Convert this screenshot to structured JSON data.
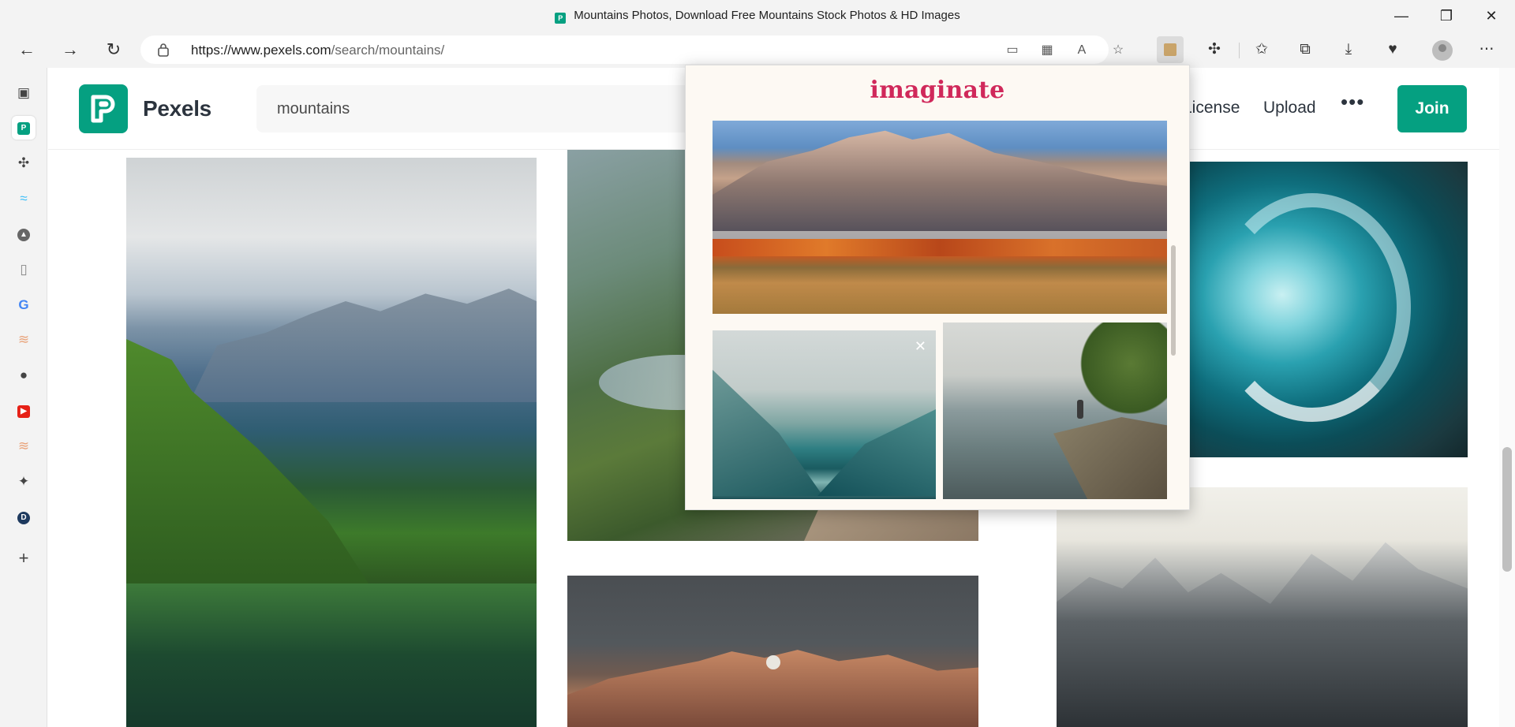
{
  "window": {
    "title": "Mountains Photos, Download Free Mountains Stock Photos & HD Images",
    "controls": {
      "minimize": "—",
      "restore": "❐",
      "close": "✕"
    }
  },
  "toolbar": {
    "url_domain": "https://www.pexels.com",
    "url_path": "/search/mountains/",
    "icons": [
      "back-icon",
      "forward-icon",
      "refresh-icon",
      "lock-icon",
      "app-available-icon",
      "qr-icon",
      "read-aloud-icon",
      "add-favorite-icon",
      "extension-imaginate-icon",
      "extensions-icon",
      "favorites-icon",
      "collections-icon",
      "downloads-icon",
      "health-icon",
      "profile-icon",
      "more-icon"
    ]
  },
  "sidebar": {
    "items": [
      "tabs-icon",
      "pexels-icon",
      "extension-icon",
      "tailwind-icon",
      "gitkraken-icon",
      "document-icon",
      "google-icon",
      "app-icon",
      "github-icon",
      "youtube-icon",
      "app-icon-2",
      "sparkle-icon",
      "d-icon",
      "add-icon"
    ]
  },
  "site": {
    "brand": "Pexels",
    "search_value": "mountains",
    "nav": {
      "license": "License",
      "upload": "Upload",
      "more": "•••",
      "join": "Join"
    }
  },
  "popup": {
    "title": "imaginate",
    "close": "✕"
  }
}
